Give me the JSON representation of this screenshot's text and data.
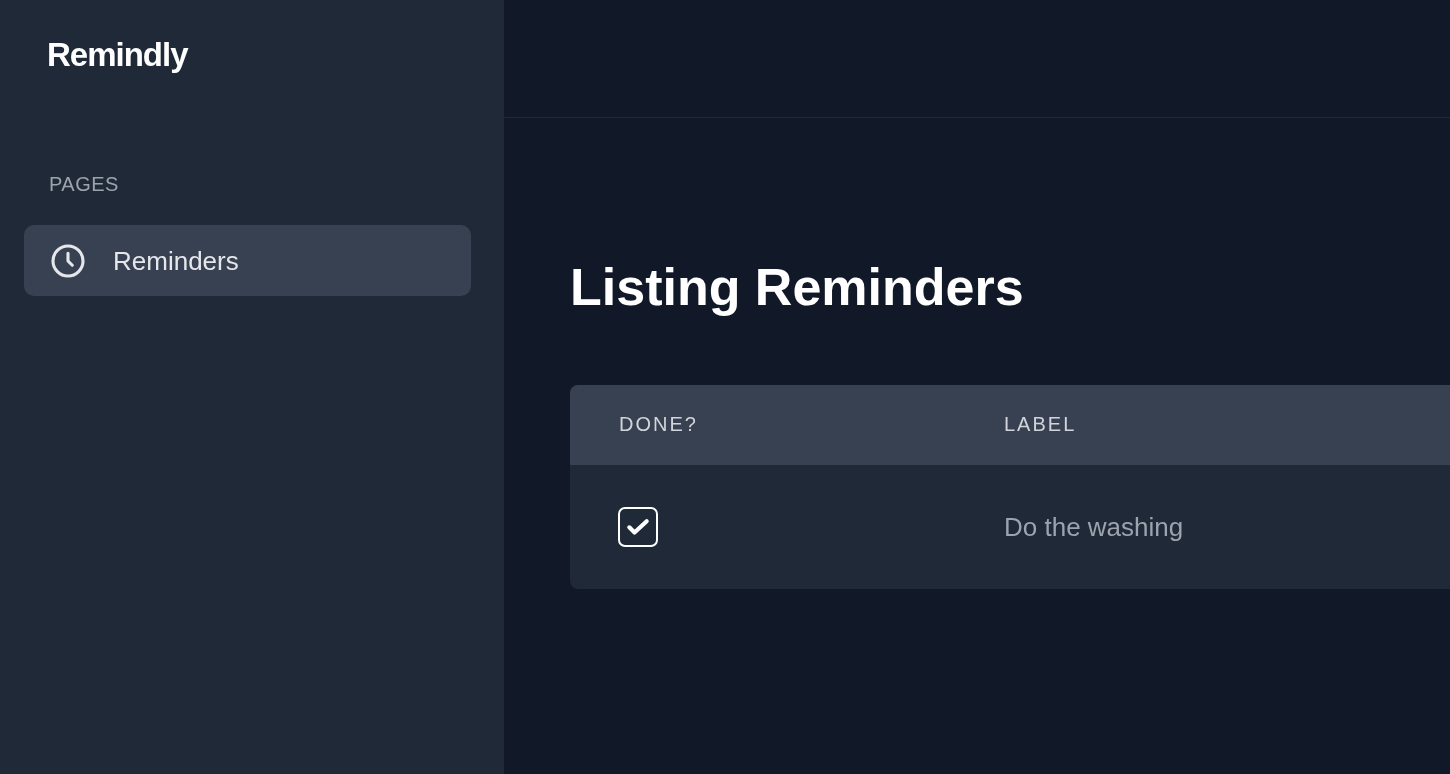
{
  "sidebar": {
    "logo": "Remindly",
    "section_title": "PAGES",
    "items": [
      {
        "label": "Reminders",
        "selected": true
      }
    ]
  },
  "page": {
    "title": "Listing Reminders"
  },
  "table": {
    "columns": [
      "DONE?",
      "LABEL"
    ],
    "rows": [
      {
        "done": true,
        "label": "Do the washing"
      }
    ]
  }
}
